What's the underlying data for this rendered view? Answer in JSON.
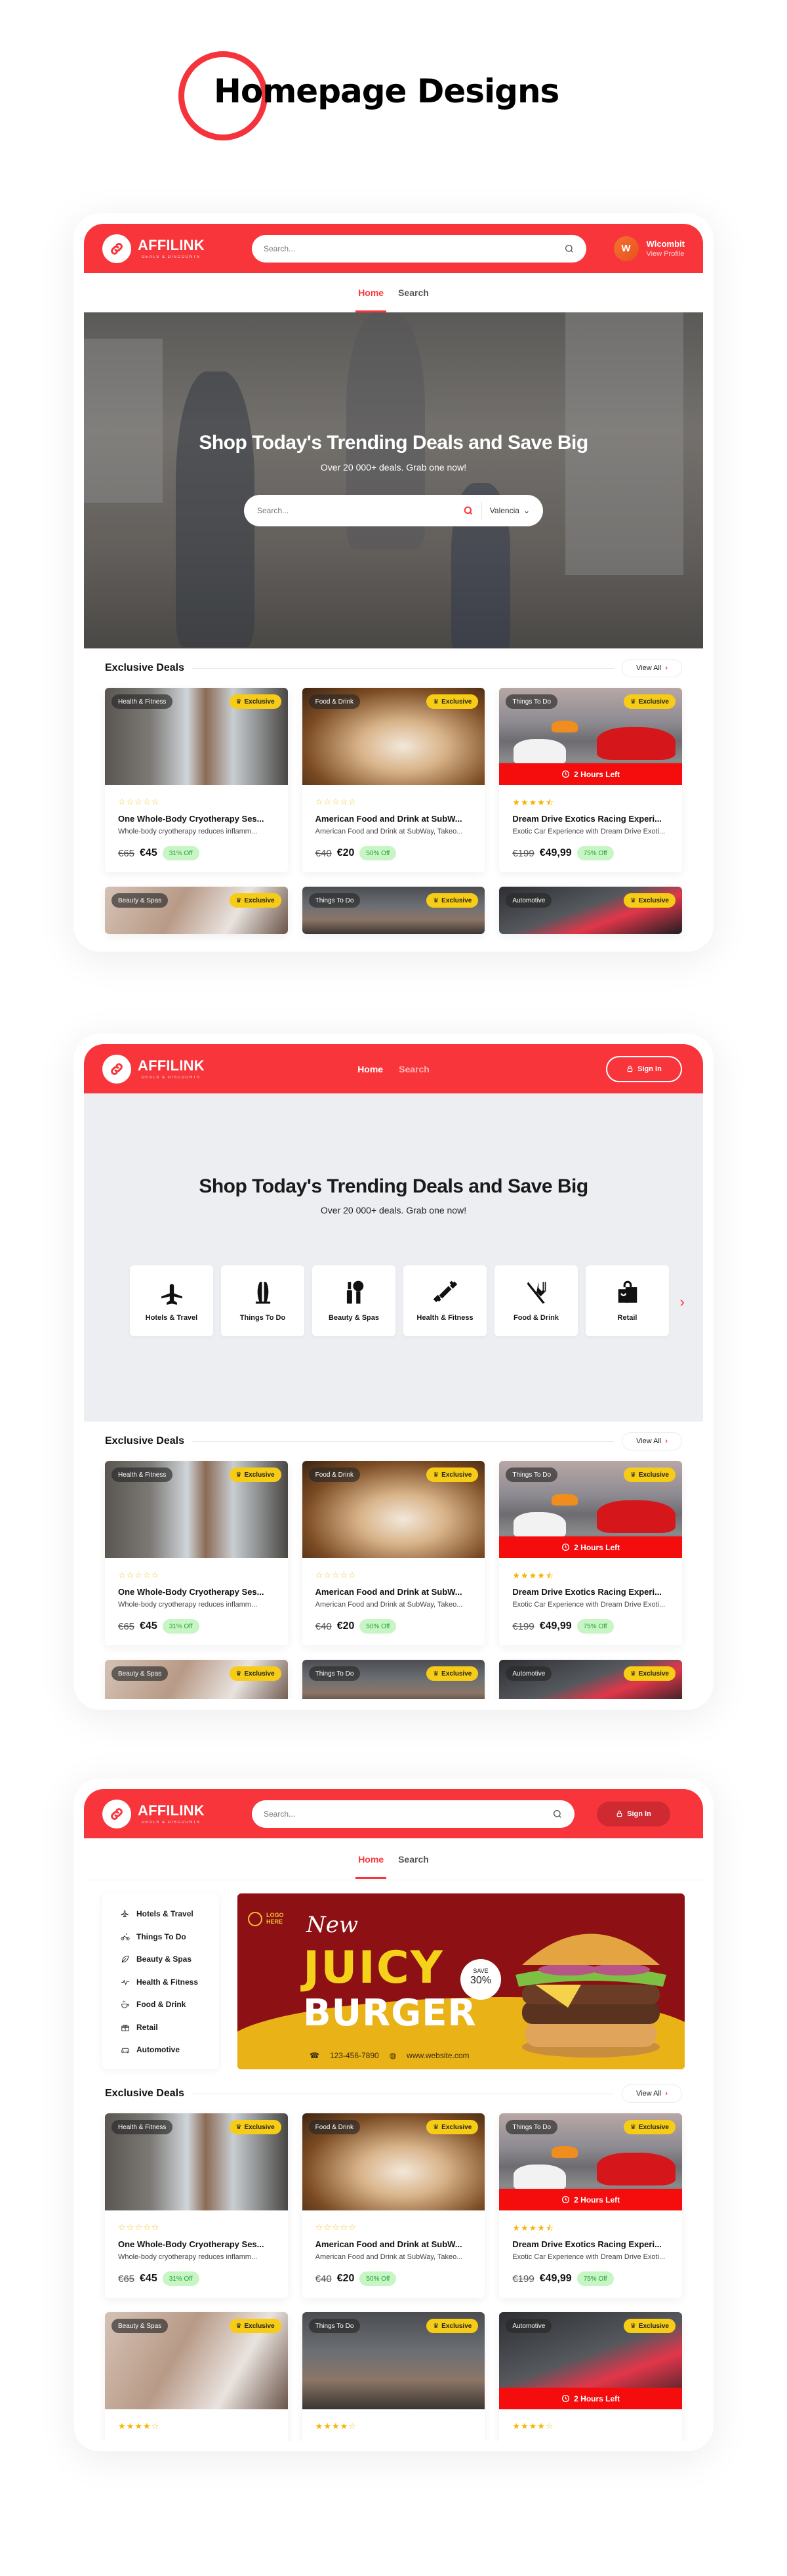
{
  "page": {
    "title": "Homepage Designs"
  },
  "brand": {
    "name": "AFFILINK",
    "tagline": "DEALS & DISCOUNTS",
    "accent": "#f8353b",
    "exclusive_color": "#f7cc16",
    "discount_bg": "#c8f5c4",
    "discount_text": "#22a13b",
    "timer_color": "#f50d0d"
  },
  "header": {
    "search_placeholder": "Search...",
    "user_initial": "W",
    "user_name": "Wlcombit",
    "user_link": "View Profile",
    "nav": [
      "Home",
      "Search"
    ],
    "sign_in": "Sign In"
  },
  "hero": {
    "title": "Shop Today's Trending Deals and Save Big",
    "subtitle": "Over 20 000+ deals. Grab one now!",
    "search_placeholder": "Search...",
    "location": "Valencia"
  },
  "categories": [
    {
      "label": "Hotels & Travel",
      "icon": "airplane-icon"
    },
    {
      "label": "Things To Do",
      "icon": "surfboard-icon"
    },
    {
      "label": "Beauty & Spas",
      "icon": "makeup-icon"
    },
    {
      "label": "Health & Fitness",
      "icon": "dumbbell-icon"
    },
    {
      "label": "Food & Drink",
      "icon": "utensils-icon"
    },
    {
      "label": "Retail",
      "icon": "shopping-bag-icon"
    }
  ],
  "side_menu": [
    {
      "label": "Hotels & Travel",
      "icon": "airplane-icon"
    },
    {
      "label": "Things To Do",
      "icon": "bicycle-icon"
    },
    {
      "label": "Beauty & Spas",
      "icon": "leaf-icon"
    },
    {
      "label": "Health & Fitness",
      "icon": "pulse-icon"
    },
    {
      "label": "Food & Drink",
      "icon": "coffee-icon"
    },
    {
      "label": "Retail",
      "icon": "gift-icon"
    },
    {
      "label": "Automotive",
      "icon": "car-icon"
    }
  ],
  "banner": {
    "logo_line1": "LOGO",
    "logo_line2": "HERE",
    "word1": "New",
    "word2": "JUICY",
    "word3": "BURGER",
    "save_label": "SAVE",
    "save_value": "30%",
    "phone": "123-456-7890",
    "website": "www.website.com"
  },
  "deals": {
    "title": "Exclusive Deals",
    "view_all": "View All",
    "exclusive_label": "Exclusive",
    "timer_label": "2 Hours Left",
    "items": [
      {
        "category": "Health & Fitness",
        "rating": 0,
        "title": "One Whole-Body Cryotherapy Ses...",
        "desc": "Whole-body cryotherapy reduces inflamm...",
        "old_price": "€65",
        "price": "€45",
        "discount": "31% Off",
        "timer": false
      },
      {
        "category": "Food & Drink",
        "rating": 0,
        "title": "American Food and Drink at SubW...",
        "desc": "American Food and Drink at SubWay, Takeo...",
        "old_price": "€40",
        "price": "€20",
        "discount": "50% Off",
        "timer": false
      },
      {
        "category": "Things To Do",
        "rating": 4.5,
        "title": "Dream Drive Exotics Racing Experi...",
        "desc": "Exotic Car Experience with Dream Drive Exoti...",
        "old_price": "€199",
        "price": "€49,99",
        "discount": "75% Off",
        "timer": true
      }
    ],
    "second_row": [
      {
        "category": "Beauty & Spas",
        "rating": 4
      },
      {
        "category": "Things To Do",
        "rating": 4
      },
      {
        "category": "Automotive",
        "rating": 4,
        "timer": true
      }
    ]
  }
}
